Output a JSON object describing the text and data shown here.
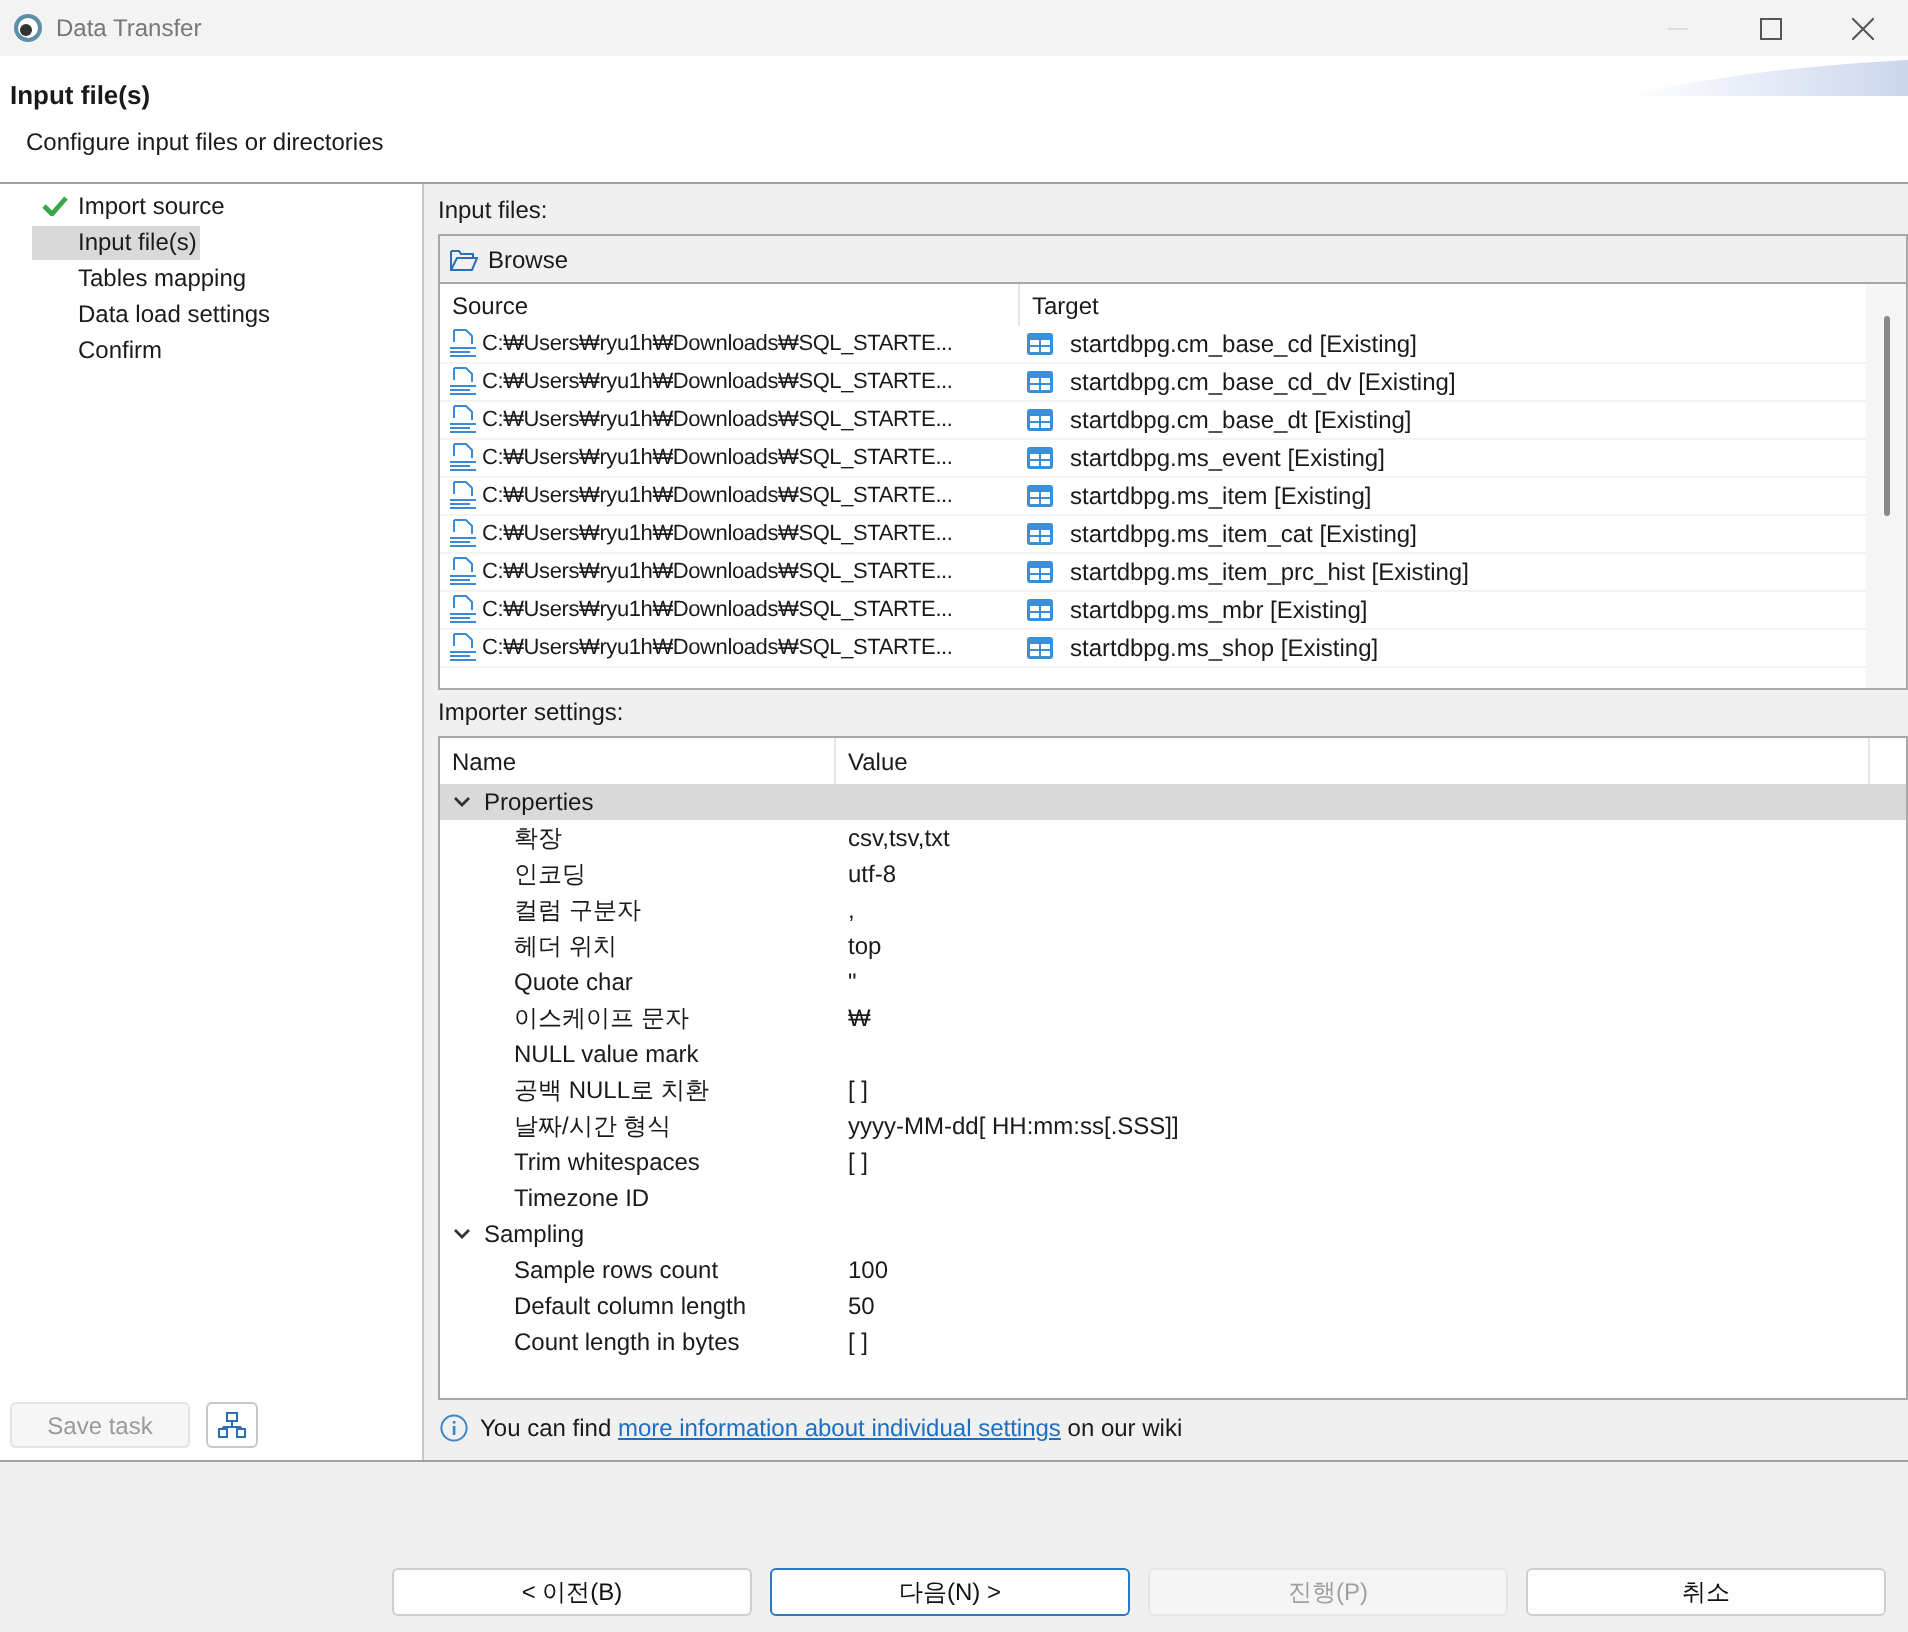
{
  "window": {
    "title": "Data Transfer"
  },
  "header": {
    "title": "Input file(s)",
    "subtitle": "Configure input files or directories"
  },
  "steps": [
    {
      "label": "Import source",
      "done": true,
      "selected": false
    },
    {
      "label": "Input file(s)",
      "done": false,
      "selected": true
    },
    {
      "label": "Tables mapping",
      "done": false,
      "selected": false
    },
    {
      "label": "Data load settings",
      "done": false,
      "selected": false
    },
    {
      "label": "Confirm",
      "done": false,
      "selected": false
    }
  ],
  "save_task": {
    "label": "Save task",
    "disabled": true
  },
  "input_files": {
    "label": "Input files:",
    "browse": "Browse",
    "columns": [
      "Source",
      "Target"
    ],
    "rows": [
      {
        "source": "C:₩Users₩ryu1h₩Downloads₩SQL_STARTE...",
        "target": "startdbpg.cm_base_cd [Existing]"
      },
      {
        "source": "C:₩Users₩ryu1h₩Downloads₩SQL_STARTE...",
        "target": "startdbpg.cm_base_cd_dv [Existing]"
      },
      {
        "source": "C:₩Users₩ryu1h₩Downloads₩SQL_STARTE...",
        "target": "startdbpg.cm_base_dt [Existing]"
      },
      {
        "source": "C:₩Users₩ryu1h₩Downloads₩SQL_STARTE...",
        "target": "startdbpg.ms_event [Existing]"
      },
      {
        "source": "C:₩Users₩ryu1h₩Downloads₩SQL_STARTE...",
        "target": "startdbpg.ms_item [Existing]"
      },
      {
        "source": "C:₩Users₩ryu1h₩Downloads₩SQL_STARTE...",
        "target": "startdbpg.ms_item_cat [Existing]"
      },
      {
        "source": "C:₩Users₩ryu1h₩Downloads₩SQL_STARTE...",
        "target": "startdbpg.ms_item_prc_hist [Existing]"
      },
      {
        "source": "C:₩Users₩ryu1h₩Downloads₩SQL_STARTE...",
        "target": "startdbpg.ms_mbr [Existing]"
      },
      {
        "source": "C:₩Users₩ryu1h₩Downloads₩SQL_STARTE...",
        "target": "startdbpg.ms_shop [Existing]"
      }
    ]
  },
  "importer_settings": {
    "label": "Importer settings:",
    "columns": [
      "Name",
      "Value"
    ],
    "groups": [
      {
        "name": "Properties",
        "expanded": true,
        "selected": true,
        "children": [
          {
            "name": "확장",
            "value": "csv,tsv,txt"
          },
          {
            "name": "인코딩",
            "value": "utf-8"
          },
          {
            "name": "컬럼 구분자",
            "value": ","
          },
          {
            "name": "헤더 위치",
            "value": "top"
          },
          {
            "name": "Quote char",
            "value": "\""
          },
          {
            "name": "이스케이프 문자",
            "value": "₩"
          },
          {
            "name": "NULL value mark"
          },
          {
            "name": "공백 NULL로 치환",
            "value": "[ ]"
          },
          {
            "name": "날짜/시간 형식",
            "value": "yyyy-MM-dd[ HH:mm:ss[.SSS]]"
          },
          {
            "name": "Trim whitespaces",
            "value": "[ ]"
          },
          {
            "name": "Timezone ID"
          }
        ]
      },
      {
        "name": "Sampling",
        "expanded": true,
        "selected": false,
        "children": [
          {
            "name": "Sample rows count",
            "value": "100"
          },
          {
            "name": "Default column length",
            "value": "50"
          },
          {
            "name": "Count length in bytes",
            "value": "[ ]"
          }
        ]
      }
    ]
  },
  "info": {
    "before": "You can find",
    "link": "more information about individual settings",
    "after": "on our wiki"
  },
  "buttons": [
    {
      "label": "< 이전(B)",
      "disabled": false,
      "default": false
    },
    {
      "label": "다음(N) >",
      "disabled": false,
      "default": true
    },
    {
      "label": "진행(P)",
      "disabled": true,
      "default": false
    },
    {
      "label": "취소",
      "disabled": false,
      "default": false
    }
  ]
}
